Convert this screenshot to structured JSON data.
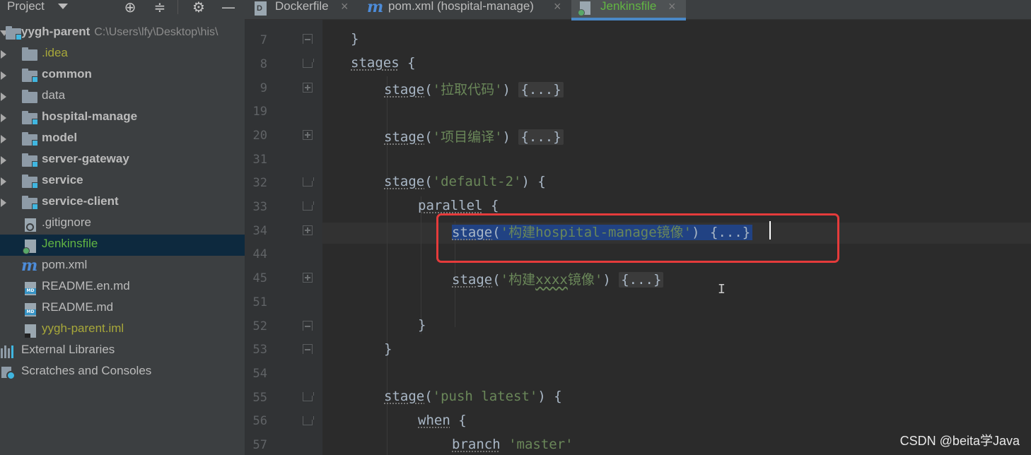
{
  "project_panel": {
    "title": "Project",
    "root": {
      "name": "yygh-parent",
      "path": "C:\\Users\\lfy\\Desktop\\his\\"
    },
    "items": [
      {
        "label": ".idea",
        "type": "folder"
      },
      {
        "label": "common",
        "type": "module"
      },
      {
        "label": "data",
        "type": "folder"
      },
      {
        "label": "hospital-manage",
        "type": "module"
      },
      {
        "label": "model",
        "type": "module"
      },
      {
        "label": "server-gateway",
        "type": "module"
      },
      {
        "label": "service",
        "type": "module"
      },
      {
        "label": "service-client",
        "type": "module"
      },
      {
        "label": ".gitignore",
        "type": "file"
      },
      {
        "label": "Jenkinsfile",
        "type": "file",
        "selected": true
      },
      {
        "label": "pom.xml",
        "type": "maven"
      },
      {
        "label": "README.en.md",
        "type": "markdown"
      },
      {
        "label": "README.md",
        "type": "markdown"
      },
      {
        "label": "yygh-parent.iml",
        "type": "file"
      }
    ],
    "external_libraries": "External Libraries",
    "scratches": "Scratches and Consoles"
  },
  "tabs": [
    {
      "label": "Dockerfile",
      "active": false
    },
    {
      "label": "pom.xml (hospital-manage)",
      "active": false
    },
    {
      "label": "Jenkinsfile",
      "active": true
    }
  ],
  "editor": {
    "lines": [
      {
        "num": "7",
        "text": "}"
      },
      {
        "num": "8",
        "kw": "stages",
        "rest": " {"
      },
      {
        "num": "9",
        "kw": "stage",
        "str": "'拉取代码'",
        "folded": "{...}"
      },
      {
        "num": "19",
        "text": ""
      },
      {
        "num": "20",
        "kw": "stage",
        "str": "'项目编译'",
        "folded": "{...}"
      },
      {
        "num": "31",
        "text": ""
      },
      {
        "num": "32",
        "kw": "stage",
        "str": "'default-2'",
        "rest": " {"
      },
      {
        "num": "33",
        "kw": "parallel",
        "rest": " {"
      },
      {
        "num": "34",
        "kw": "stage",
        "str": "'构建hospital-manage镜像'",
        "folded": "{...}"
      },
      {
        "num": "44",
        "text": ""
      },
      {
        "num": "45",
        "kw": "stage",
        "str_pre": "'构建",
        "str_typo": "xxxx",
        "str_post": "镜像'",
        "folded": "{...}"
      },
      {
        "num": "51",
        "text": ""
      },
      {
        "num": "52",
        "text": "}"
      },
      {
        "num": "53",
        "text": "}"
      },
      {
        "num": "54",
        "text": ""
      },
      {
        "num": "55",
        "kw": "stage",
        "str": "'push latest'",
        "rest": " {"
      },
      {
        "num": "56",
        "kw": "when",
        "rest": " {"
      },
      {
        "num": "57",
        "kw": "branch",
        "str": "'master'"
      }
    ]
  },
  "watermark": "CSDN @beita学Java",
  "colors": {
    "highlight_box": "#e53b3b",
    "selection": "#214283",
    "string": "#6a8759",
    "active_tab_underline": "#4a88c7"
  }
}
